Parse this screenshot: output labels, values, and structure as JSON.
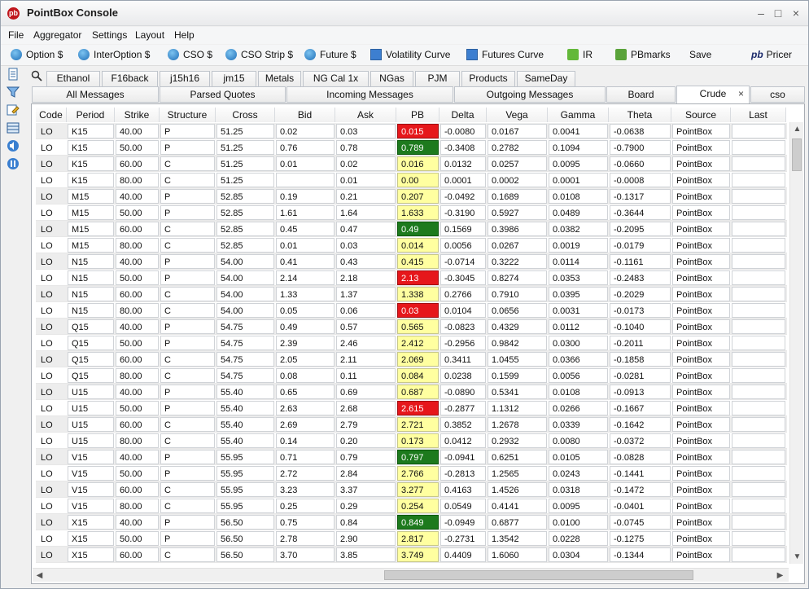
{
  "app": {
    "title": "PointBox Console"
  },
  "menu": [
    "File",
    "Aggregator",
    "Settings",
    "Layout",
    "Help"
  ],
  "toolbar": {
    "buttons": [
      "Option $",
      "InterOption $",
      "CSO $",
      "CSO Strip $",
      "Future $",
      "Volatility Curve",
      "Futures Curve",
      "IR",
      "PBmarks",
      "Save",
      "Pricer"
    ],
    "pb_logo": "pb"
  },
  "tabs_row1": [
    "Ethanol",
    "F16back",
    "j15h16",
    "jm15",
    "Metals",
    "NG Cal 1x",
    "NGas",
    "PJM",
    "Products",
    "SameDay"
  ],
  "tabs_row2": [
    "All Messages",
    "Parsed Quotes",
    "Incoming Messages",
    "Outgoing Messages",
    "Board",
    "Crude",
    "cso"
  ],
  "active_tab": "Crude",
  "tab_close_glyph": "×",
  "columns": [
    "Code",
    "Period",
    "Strike",
    "Structure",
    "Cross",
    "Bid",
    "Ask",
    "PB",
    "Delta",
    "Vega",
    "Gamma",
    "Theta",
    "Source",
    "Last"
  ],
  "rows": [
    [
      "LO",
      "K15",
      "40.00",
      "P",
      "51.25",
      "0.02",
      "0.03",
      "0.015",
      "-0.0080",
      "0.0167",
      "0.0041",
      "-0.0638",
      "PointBox",
      ""
    ],
    [
      "LO",
      "K15",
      "50.00",
      "P",
      "51.25",
      "0.76",
      "0.78",
      "0.789",
      "-0.3408",
      "0.2782",
      "0.1094",
      "-0.7900",
      "PointBox",
      ""
    ],
    [
      "LO",
      "K15",
      "60.00",
      "C",
      "51.25",
      "0.01",
      "0.02",
      "0.016",
      "0.0132",
      "0.0257",
      "0.0095",
      "-0.0660",
      "PointBox",
      ""
    ],
    [
      "LO",
      "K15",
      "80.00",
      "C",
      "51.25",
      "",
      "0.01",
      "0.00",
      "0.0001",
      "0.0002",
      "0.0001",
      "-0.0008",
      "PointBox",
      ""
    ],
    [
      "LO",
      "M15",
      "40.00",
      "P",
      "52.85",
      "0.19",
      "0.21",
      "0.207",
      "-0.0492",
      "0.1689",
      "0.0108",
      "-0.1317",
      "PointBox",
      ""
    ],
    [
      "LO",
      "M15",
      "50.00",
      "P",
      "52.85",
      "1.61",
      "1.64",
      "1.633",
      "-0.3190",
      "0.5927",
      "0.0489",
      "-0.3644",
      "PointBox",
      ""
    ],
    [
      "LO",
      "M15",
      "60.00",
      "C",
      "52.85",
      "0.45",
      "0.47",
      "0.49",
      "0.1569",
      "0.3986",
      "0.0382",
      "-0.2095",
      "PointBox",
      ""
    ],
    [
      "LO",
      "M15",
      "80.00",
      "C",
      "52.85",
      "0.01",
      "0.03",
      "0.014",
      "0.0056",
      "0.0267",
      "0.0019",
      "-0.0179",
      "PointBox",
      ""
    ],
    [
      "LO",
      "N15",
      "40.00",
      "P",
      "54.00",
      "0.41",
      "0.43",
      "0.415",
      "-0.0714",
      "0.3222",
      "0.0114",
      "-0.1161",
      "PointBox",
      ""
    ],
    [
      "LO",
      "N15",
      "50.00",
      "P",
      "54.00",
      "2.14",
      "2.18",
      "2.13",
      "-0.3045",
      "0.8274",
      "0.0353",
      "-0.2483",
      "PointBox",
      ""
    ],
    [
      "LO",
      "N15",
      "60.00",
      "C",
      "54.00",
      "1.33",
      "1.37",
      "1.338",
      "0.2766",
      "0.7910",
      "0.0395",
      "-0.2029",
      "PointBox",
      ""
    ],
    [
      "LO",
      "N15",
      "80.00",
      "C",
      "54.00",
      "0.05",
      "0.06",
      "0.03",
      "0.0104",
      "0.0656",
      "0.0031",
      "-0.0173",
      "PointBox",
      ""
    ],
    [
      "LO",
      "Q15",
      "40.00",
      "P",
      "54.75",
      "0.49",
      "0.57",
      "0.565",
      "-0.0823",
      "0.4329",
      "0.0112",
      "-0.1040",
      "PointBox",
      ""
    ],
    [
      "LO",
      "Q15",
      "50.00",
      "P",
      "54.75",
      "2.39",
      "2.46",
      "2.412",
      "-0.2956",
      "0.9842",
      "0.0300",
      "-0.2011",
      "PointBox",
      ""
    ],
    [
      "LO",
      "Q15",
      "60.00",
      "C",
      "54.75",
      "2.05",
      "2.11",
      "2.069",
      "0.3411",
      "1.0455",
      "0.0366",
      "-0.1858",
      "PointBox",
      ""
    ],
    [
      "LO",
      "Q15",
      "80.00",
      "C",
      "54.75",
      "0.08",
      "0.11",
      "0.084",
      "0.0238",
      "0.1599",
      "0.0056",
      "-0.0281",
      "PointBox",
      ""
    ],
    [
      "LO",
      "U15",
      "40.00",
      "P",
      "55.40",
      "0.65",
      "0.69",
      "0.687",
      "-0.0890",
      "0.5341",
      "0.0108",
      "-0.0913",
      "PointBox",
      ""
    ],
    [
      "LO",
      "U15",
      "50.00",
      "P",
      "55.40",
      "2.63",
      "2.68",
      "2.615",
      "-0.2877",
      "1.1312",
      "0.0266",
      "-0.1667",
      "PointBox",
      ""
    ],
    [
      "LO",
      "U15",
      "60.00",
      "C",
      "55.40",
      "2.69",
      "2.79",
      "2.721",
      "0.3852",
      "1.2678",
      "0.0339",
      "-0.1642",
      "PointBox",
      ""
    ],
    [
      "LO",
      "U15",
      "80.00",
      "C",
      "55.40",
      "0.14",
      "0.20",
      "0.173",
      "0.0412",
      "0.2932",
      "0.0080",
      "-0.0372",
      "PointBox",
      ""
    ],
    [
      "LO",
      "V15",
      "40.00",
      "P",
      "55.95",
      "0.71",
      "0.79",
      "0.797",
      "-0.0941",
      "0.6251",
      "0.0105",
      "-0.0828",
      "PointBox",
      ""
    ],
    [
      "LO",
      "V15",
      "50.00",
      "P",
      "55.95",
      "2.72",
      "2.84",
      "2.766",
      "-0.2813",
      "1.2565",
      "0.0243",
      "-0.1441",
      "PointBox",
      ""
    ],
    [
      "LO",
      "V15",
      "60.00",
      "C",
      "55.95",
      "3.23",
      "3.37",
      "3.277",
      "0.4163",
      "1.4526",
      "0.0318",
      "-0.1472",
      "PointBox",
      ""
    ],
    [
      "LO",
      "V15",
      "80.00",
      "C",
      "55.95",
      "0.25",
      "0.29",
      "0.254",
      "0.0549",
      "0.4141",
      "0.0095",
      "-0.0401",
      "PointBox",
      ""
    ],
    [
      "LO",
      "X15",
      "40.00",
      "P",
      "56.50",
      "0.75",
      "0.84",
      "0.849",
      "-0.0949",
      "0.6877",
      "0.0100",
      "-0.0745",
      "PointBox",
      ""
    ],
    [
      "LO",
      "X15",
      "50.00",
      "P",
      "56.50",
      "2.78",
      "2.90",
      "2.817",
      "-0.2731",
      "1.3542",
      "0.0228",
      "-0.1275",
      "PointBox",
      ""
    ],
    [
      "LO",
      "X15",
      "60.00",
      "C",
      "56.50",
      "3.70",
      "3.85",
      "3.749",
      "0.4409",
      "1.6060",
      "0.0304",
      "-0.1344",
      "PointBox",
      ""
    ]
  ],
  "pb_status": [
    "red",
    "green",
    "yellow",
    "yellow",
    "yellow",
    "yellow",
    "green",
    "yellow",
    "yellow",
    "red",
    "yellow",
    "red",
    "yellow",
    "yellow",
    "yellow",
    "yellow",
    "yellow",
    "red",
    "yellow",
    "yellow",
    "green",
    "yellow",
    "yellow",
    "yellow",
    "green",
    "yellow",
    "yellow"
  ],
  "colors": {
    "pb_yellow": "#ffffa0",
    "pb_green": "#1d7a1d",
    "pb_red": "#e6171b",
    "accent": "#1f6fb8"
  }
}
